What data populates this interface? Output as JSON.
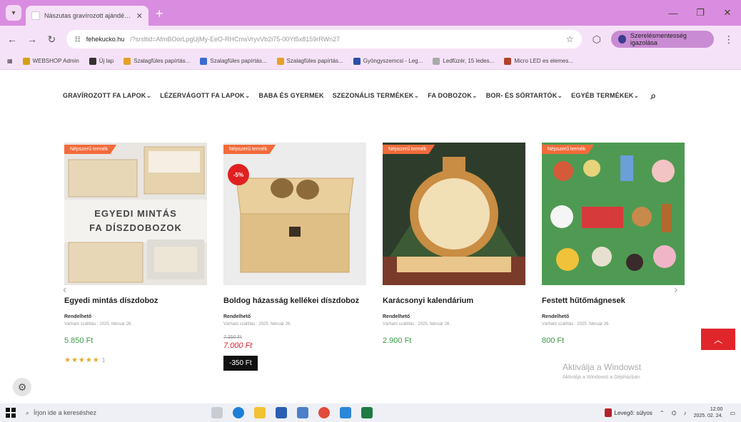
{
  "browser": {
    "tab_title": "Nászutas gravírozott ajándék...",
    "new_tab": "+",
    "url_host": "fehekucko.hu",
    "url_rest": "/?srsltid=AfmBOorLpgUjMy-EeO-RHCmsVryvVb2i75-00Yt5x8159rRWn27",
    "profile_label": "Szerelésmentesség igazolása",
    "bookmarks": [
      {
        "label": "WEBSHOP Admin",
        "color": "#d4a017"
      },
      {
        "label": "Új lap",
        "color": "#333333"
      },
      {
        "label": "Szalagfüles papírtás...",
        "color": "#e5a02a"
      },
      {
        "label": "Szalagfüles papírtás...",
        "color": "#3a6bd1"
      },
      {
        "label": "Szalagfüles papírtás...",
        "color": "#e5a02a"
      },
      {
        "label": "Gyöngyszemcsi - Leg...",
        "color": "#2d4fa8"
      },
      {
        "label": "Ledfüzér, 15 ledes...",
        "color": "#aaaaaa"
      },
      {
        "label": "Micro LED es elemes...",
        "color": "#b0432a"
      }
    ]
  },
  "site_nav": [
    "GRAVÍROZOTT FA LAPOK",
    "LÉZERVÁGOTT FA LAPOK",
    "BABA ÉS GYERMEK",
    "SZEZONÁLIS TERMÉKEK",
    "FA DOBOZOK",
    "BOR- ÉS SÖRTARTÓK",
    "EGYÉB TERMÉKEK"
  ],
  "nav_dropdown_marks": [
    "⌄",
    "⌄",
    "",
    "⌄",
    "⌄",
    "⌄",
    "⌄"
  ],
  "products": [
    {
      "badge": "Népszerű termék",
      "overlay_text_1": "EGYEDI MINTÁS",
      "overlay_text_2": "FA DÍSZDOBOZOK",
      "name": "Egyedi mintás díszdoboz",
      "vendor": "Rendelhető",
      "note": "Várható szállítás : 2025. február 26.",
      "price": "5.850 Ft",
      "stars": "★★★★★",
      "rating_count": "1"
    },
    {
      "badge": "Népszerű termék",
      "discount": "-5%",
      "name": "Boldog házasság kellékei díszdoboz",
      "vendor": "Rendelhető",
      "note": "Várható szállítás : 2025. február 26.",
      "old_price": "7.350 Ft",
      "new_price": "7.000 Ft",
      "saving": "-350 Ft"
    },
    {
      "badge": "Népszerű termék",
      "name": "Karácsonyi kalendárium",
      "vendor": "Rendelhető",
      "note": "Várható szállítás : 2025. február 26.",
      "price": "2.900 Ft"
    },
    {
      "badge": "Népszerű termék",
      "name": "Festett hűtőmágnesek",
      "vendor": "Rendelhető",
      "note": "Várható szállítás : 2025. február 26.",
      "price": "800 Ft"
    }
  ],
  "activate_windows": {
    "title": "Aktiválja a Windowst",
    "subtitle": "Aktiválja a Windowst a Gépházban."
  },
  "taskbar": {
    "search_placeholder": "Írjon ide a kereséshez",
    "weather": "Levegő: súlyos",
    "time": "12:00",
    "date": "2025. 02. 24."
  },
  "colors": {
    "browser_frame": "#d98de0",
    "badge": "#f26b3a",
    "price_green": "#3a9b45",
    "sale_red": "#e0262b"
  }
}
